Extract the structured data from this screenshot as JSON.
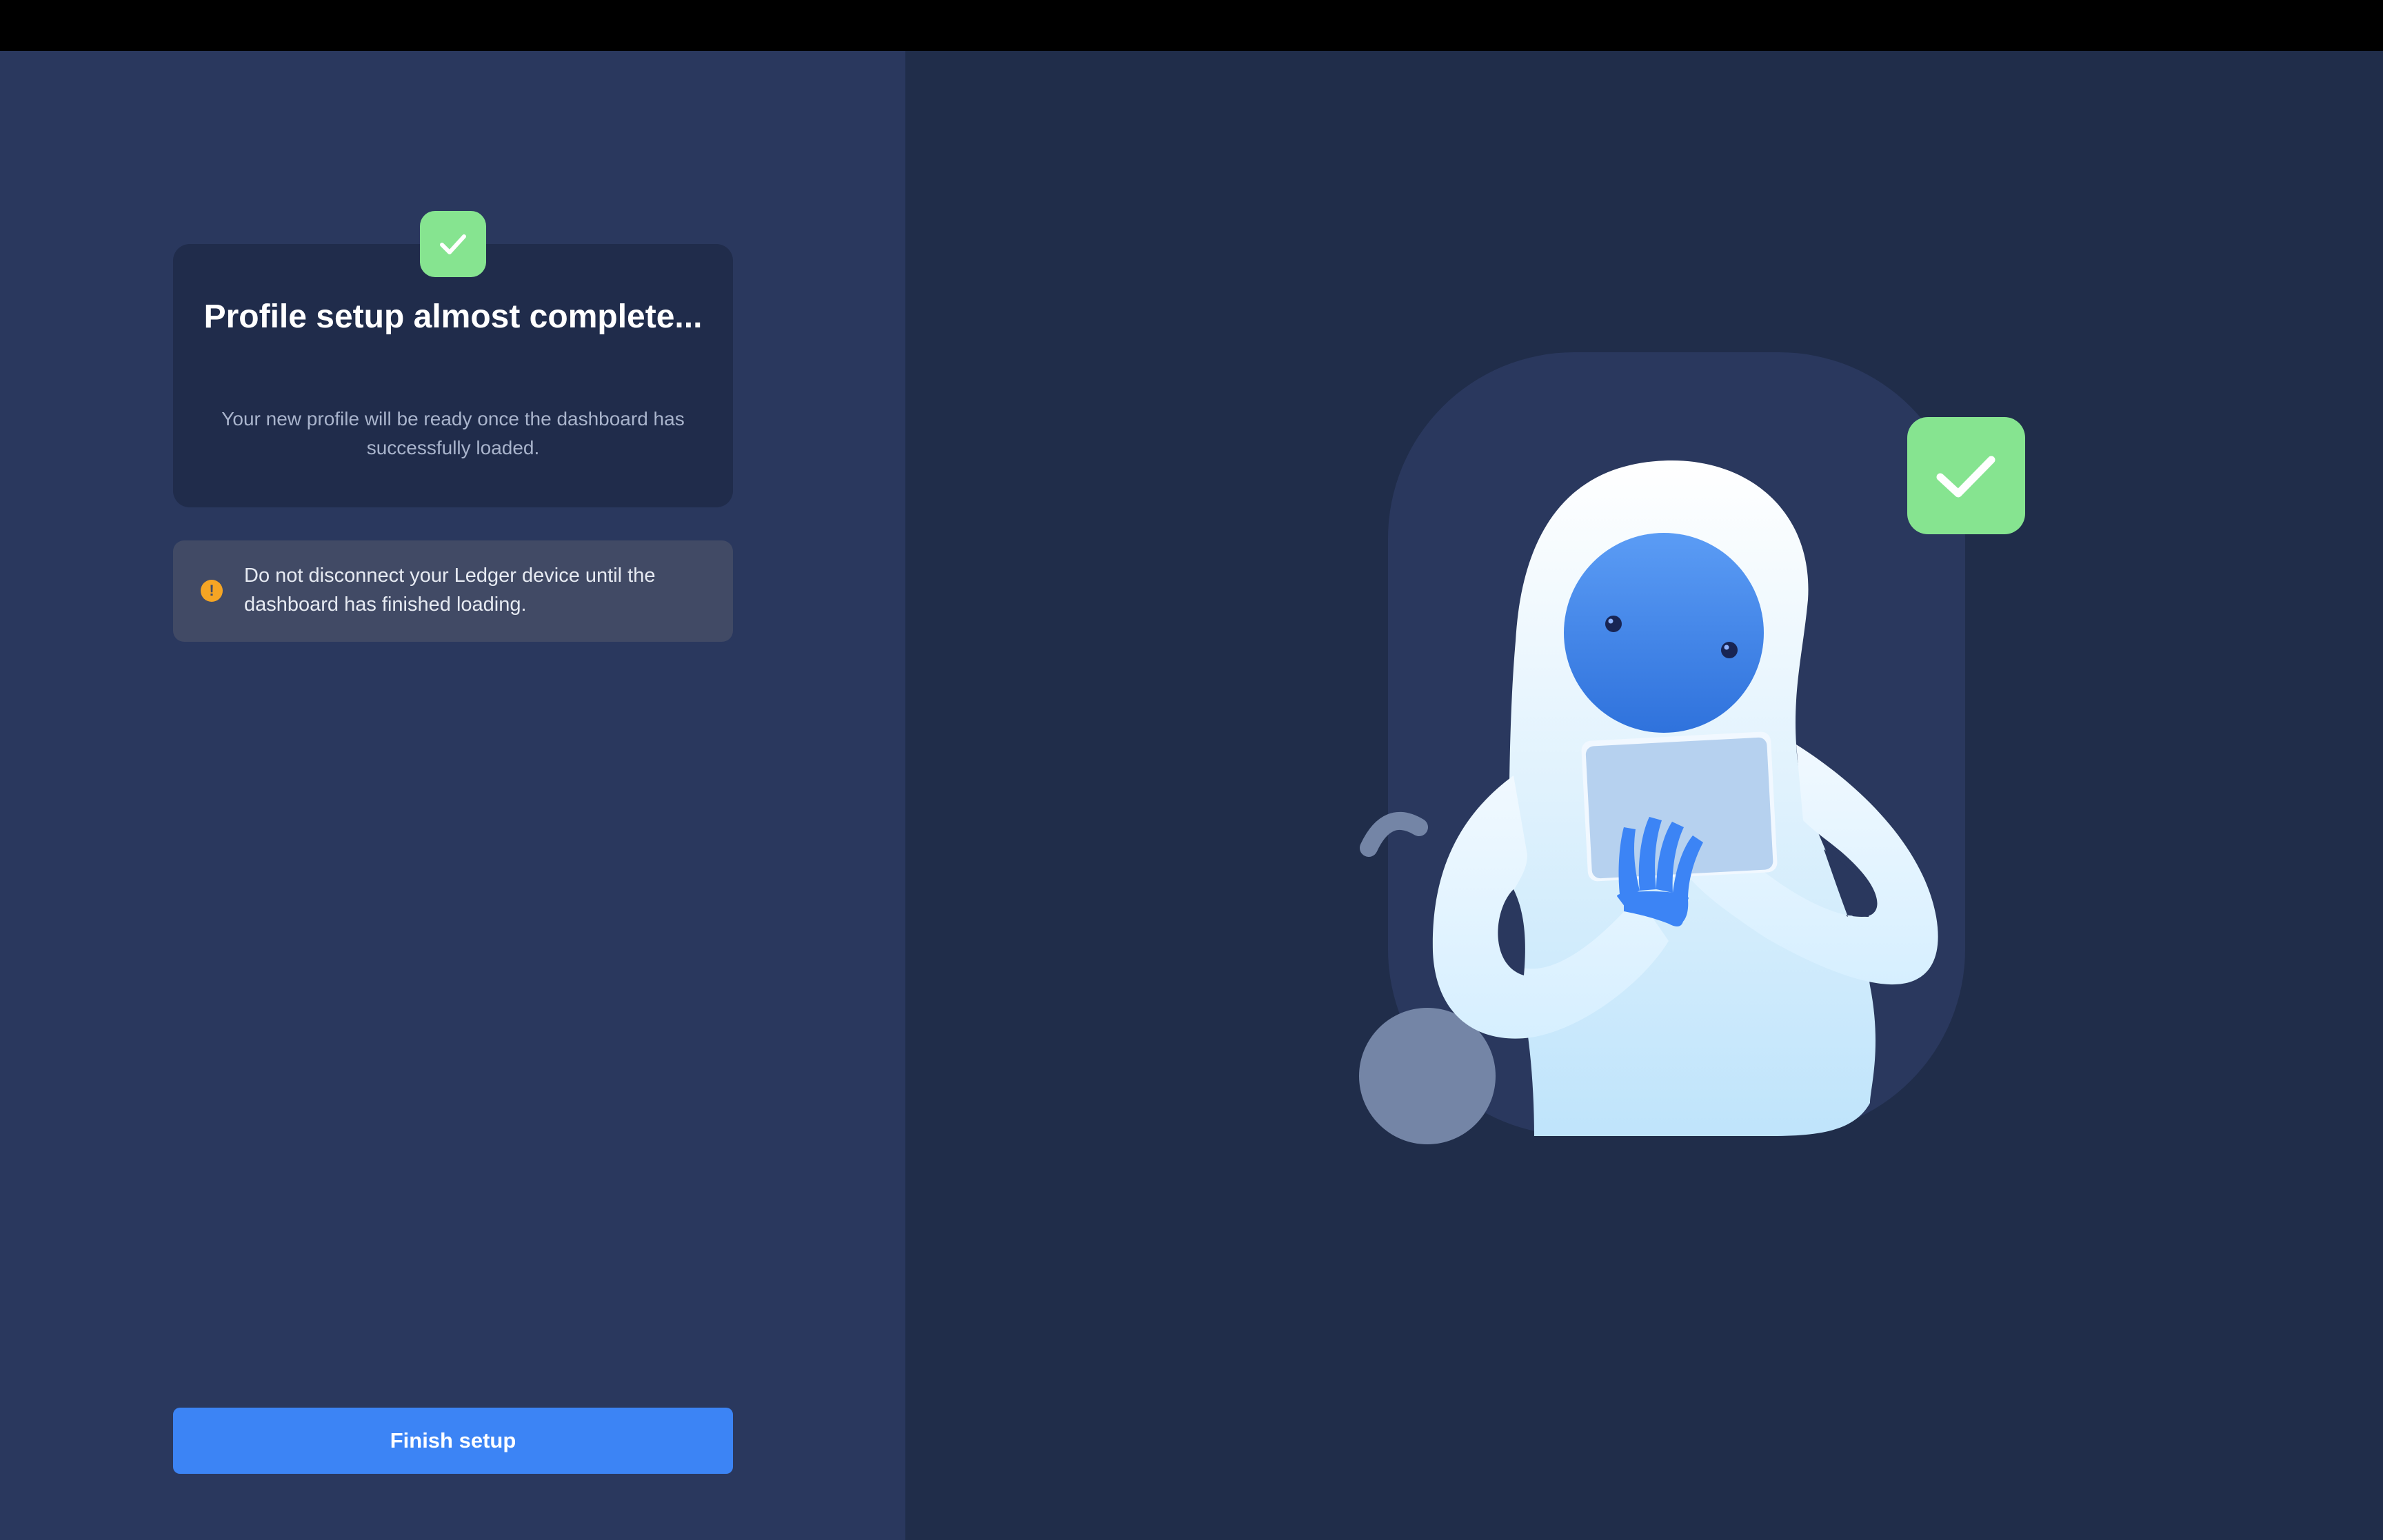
{
  "status_card": {
    "icon": "check-icon",
    "title": "Profile setup almost complete...",
    "description": "Your new profile will be ready once the dashboard has successfully loaded."
  },
  "warning": {
    "icon": "warning-icon",
    "icon_glyph": "!",
    "text": "Do not disconnect your Ledger device until the dashboard has finished loading."
  },
  "actions": {
    "finish_label": "Finish setup"
  },
  "illustration": {
    "subject": "astronaut holding tablet",
    "badge_icon": "check-icon"
  },
  "colors": {
    "accent": "#3c84f5",
    "success": "#86e490",
    "warning": "#f5a524",
    "left_background": "#2a385e",
    "right_background": "#202d4a"
  }
}
